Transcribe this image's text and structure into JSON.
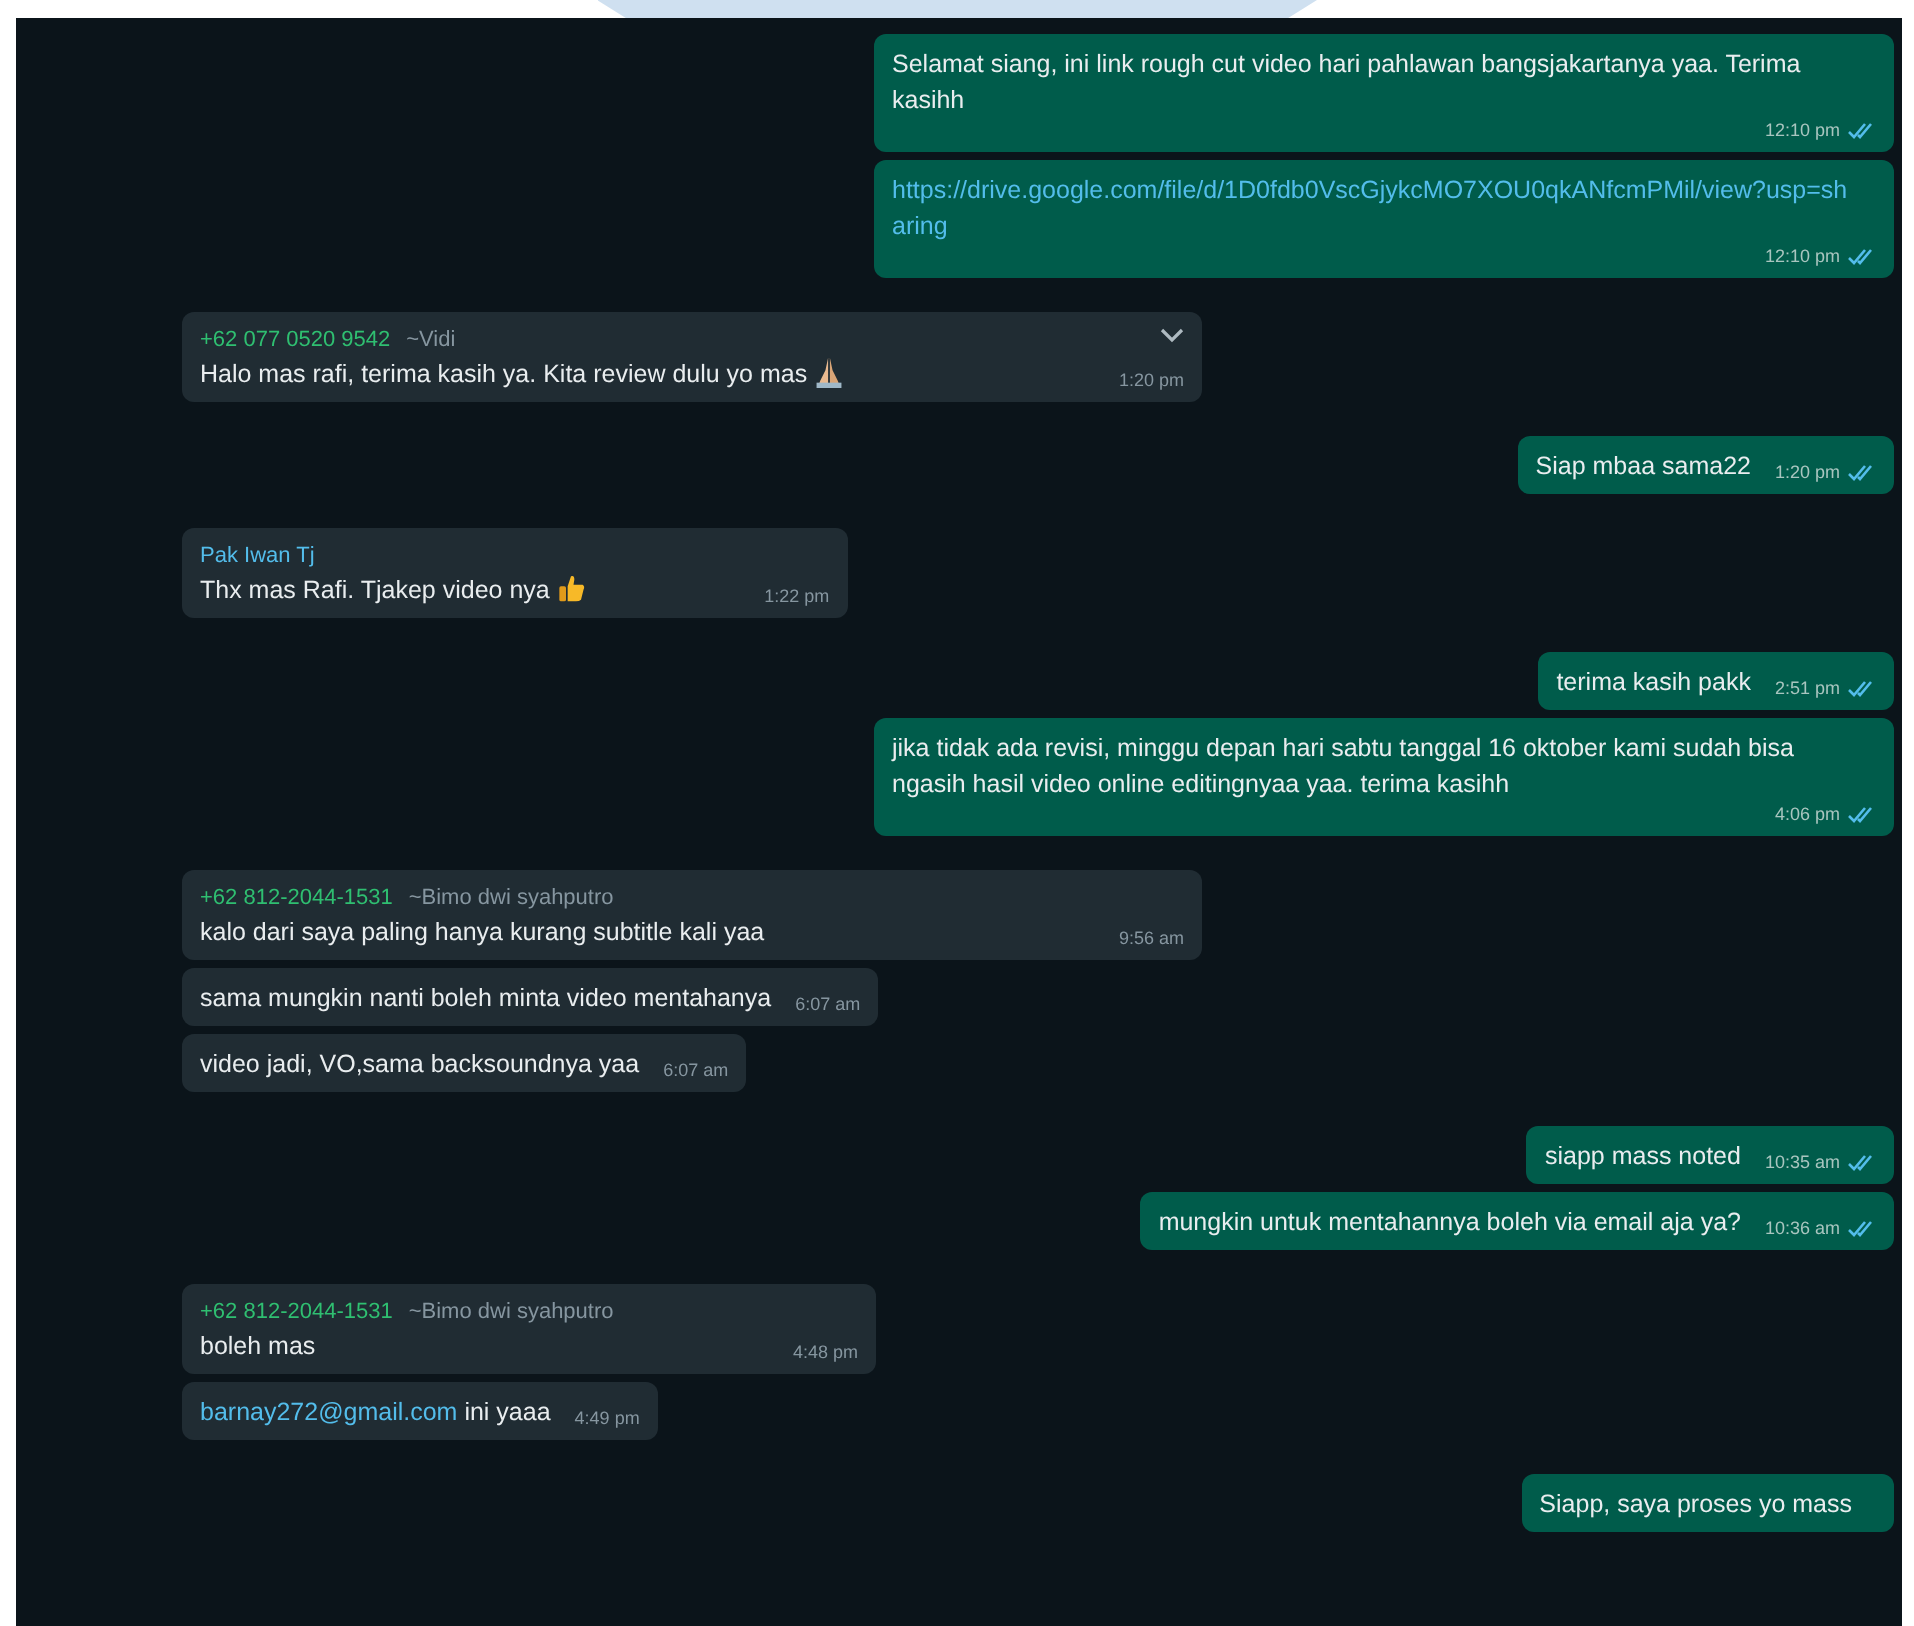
{
  "messages": [
    {
      "kind": "out",
      "parts": [
        {
          "kind": "text",
          "text": "Selamat siang, ini link rough cut video hari pahlawan  bangsjakartanya yaa. Terima kasihh"
        }
      ],
      "time": "12:10 pm",
      "read": true
    },
    {
      "kind": "out",
      "parts": [
        {
          "kind": "link",
          "text": "https://drive.google.com/file/d/1D0fdb0VscGjykcMO7XOU0qkANfcmPMil/view?usp=sharing"
        }
      ],
      "time": "12:10 pm",
      "read": true
    },
    {
      "kind": "in",
      "sender": "+62 077 0520 9542",
      "sender_note": "~Vidi",
      "color": "#2fbf71",
      "parts": [
        {
          "kind": "text",
          "text": "Halo mas rafi, terima kasih ya. Kita review dulu yo mas"
        },
        {
          "kind": "pray"
        }
      ],
      "menu": true,
      "time": "1:20 pm"
    },
    {
      "kind": "out",
      "parts": [
        {
          "kind": "text",
          "text": "Siap mbaa sama22"
        }
      ],
      "time": "1:20 pm",
      "read": true
    },
    {
      "kind": "in",
      "sender": "Pak Iwan Tj",
      "color": "#53bdeb",
      "parts": [
        {
          "kind": "text",
          "text": "Thx mas Rafi. Tjakep video nya"
        },
        {
          "kind": "thumbs"
        }
      ],
      "time": "1:22 pm"
    },
    {
      "kind": "out",
      "parts": [
        {
          "kind": "text",
          "text": "terima kasih pakk"
        }
      ],
      "time": "2:51 pm",
      "read": true
    },
    {
      "kind": "out",
      "parts": [
        {
          "kind": "text",
          "text": "jika tidak ada revisi, minggu depan hari sabtu tanggal 16 oktober kami sudah bisa ngasih hasil video online editingnyaa yaa. terima kasihh"
        }
      ],
      "time": "4:06 pm",
      "read": true
    },
    {
      "kind": "in",
      "sender": "+62 812-2044-1531",
      "sender_note": "~Bimo dwi syahputro",
      "color": "#2fbf71",
      "parts": [
        {
          "kind": "text",
          "text": "kalo dari saya paling hanya kurang subtitle kali yaa"
        }
      ],
      "time": "9:56 am"
    },
    {
      "kind": "in",
      "parts": [
        {
          "kind": "text",
          "text": "sama mungkin nanti boleh minta video mentahanya"
        }
      ],
      "time": "6:07 am"
    },
    {
      "kind": "in",
      "parts": [
        {
          "kind": "text",
          "text": "video jadi, VO,sama backsoundnya yaa"
        }
      ],
      "time": "6:07 am"
    },
    {
      "kind": "out",
      "parts": [
        {
          "kind": "text",
          "text": "siapp mass noted"
        }
      ],
      "time": "10:35 am",
      "read": true
    },
    {
      "kind": "out",
      "parts": [
        {
          "kind": "text",
          "text": "mungkin untuk mentahannya boleh via email aja ya?"
        }
      ],
      "time": "10:36 am",
      "read": true
    },
    {
      "kind": "in",
      "sender": "+62 812-2044-1531",
      "sender_note": "~Bimo dwi syahputro",
      "color": "#2fbf71",
      "parts": [
        {
          "kind": "text",
          "text": "boleh mas"
        }
      ],
      "time": "4:48 pm"
    },
    {
      "kind": "in",
      "parts": [
        {
          "kind": "link",
          "text": "barnay272@gmail.com"
        },
        {
          "kind": "text",
          "text": " ini yaaa"
        }
      ],
      "time": "4:49 pm"
    },
    {
      "kind": "out",
      "parts": [
        {
          "kind": "text",
          "text": "Siapp, saya proses yo mass"
        }
      ]
    }
  ]
}
